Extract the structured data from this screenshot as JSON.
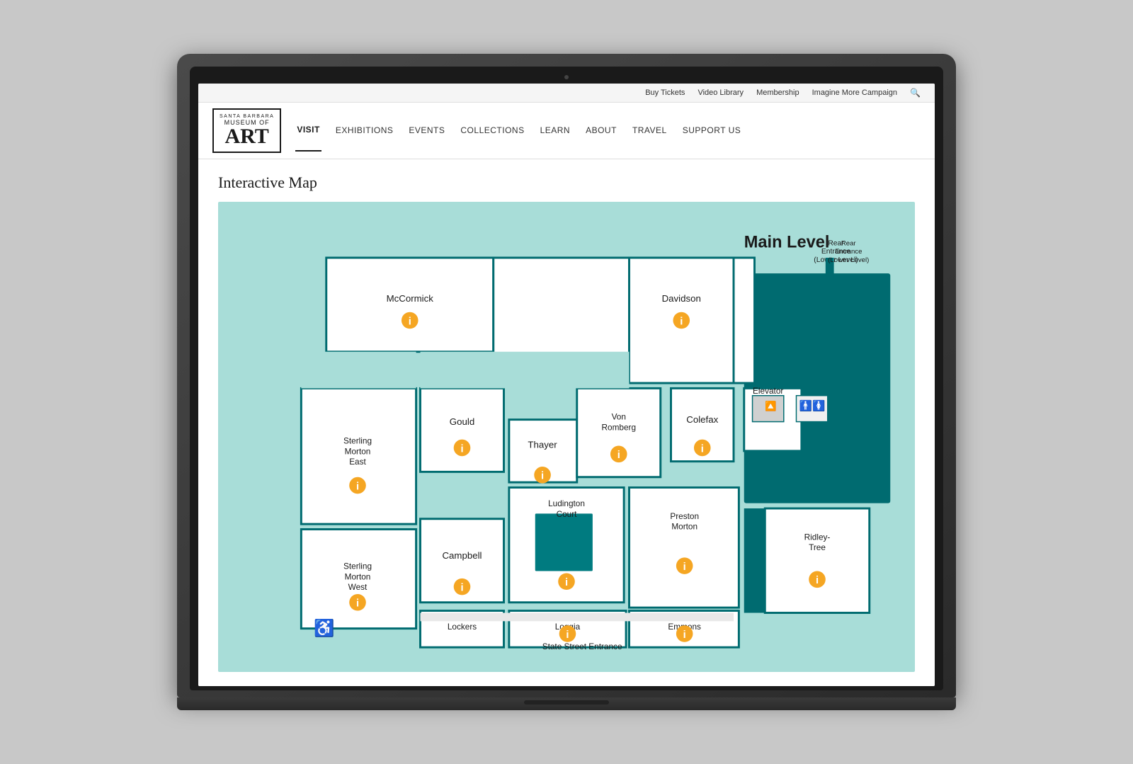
{
  "topbar": {
    "links": [
      {
        "label": "Buy Tickets",
        "name": "buy-tickets"
      },
      {
        "label": "Video Library",
        "name": "video-library"
      },
      {
        "label": "Membership",
        "name": "membership"
      },
      {
        "label": "Imagine More Campaign",
        "name": "imagine-more"
      },
      {
        "label": "🔍",
        "name": "search"
      }
    ]
  },
  "logo": {
    "top": "SANTA BARBARA",
    "middle": "MUSEUM OF",
    "art": "ART"
  },
  "nav": {
    "items": [
      {
        "label": "VISIT",
        "name": "nav-visit",
        "active": true
      },
      {
        "label": "EXHIBITIONS",
        "name": "nav-exhibitions"
      },
      {
        "label": "EVENTS",
        "name": "nav-events"
      },
      {
        "label": "COLLECTIONS",
        "name": "nav-collections"
      },
      {
        "label": "LEARN",
        "name": "nav-learn"
      },
      {
        "label": "ABOUT",
        "name": "nav-about"
      },
      {
        "label": "TRAVEL",
        "name": "nav-travel"
      },
      {
        "label": "SUPPORT US",
        "name": "nav-support"
      }
    ]
  },
  "page": {
    "title": "Interactive Map"
  },
  "map": {
    "level_label": "Main Level",
    "rooms": [
      {
        "label": "McCormick",
        "name": "mccormick"
      },
      {
        "label": "Davidson",
        "name": "davidson"
      },
      {
        "label": "Sterling Morton East",
        "name": "sterling-morton-east"
      },
      {
        "label": "Gould",
        "name": "gould"
      },
      {
        "label": "Thayer",
        "name": "thayer"
      },
      {
        "label": "Von Romberg",
        "name": "von-romberg"
      },
      {
        "label": "Colefax",
        "name": "colefax"
      },
      {
        "label": "Elevator",
        "name": "elevator"
      },
      {
        "label": "Sterling Morton West",
        "name": "sterling-morton-west"
      },
      {
        "label": "Campbell",
        "name": "campbell"
      },
      {
        "label": "Ludington Court",
        "name": "ludington-court"
      },
      {
        "label": "Preston Morton",
        "name": "preston-morton"
      },
      {
        "label": "Ridley-Tree",
        "name": "ridley-tree"
      },
      {
        "label": "Emmons",
        "name": "emmons"
      },
      {
        "label": "Loggia",
        "name": "loggia"
      },
      {
        "label": "Lockers",
        "name": "lockers"
      },
      {
        "label": "State Street Entrance",
        "name": "state-street-entrance"
      },
      {
        "label": "Rear Entrance (Lower Level)",
        "name": "rear-entrance"
      }
    ]
  }
}
